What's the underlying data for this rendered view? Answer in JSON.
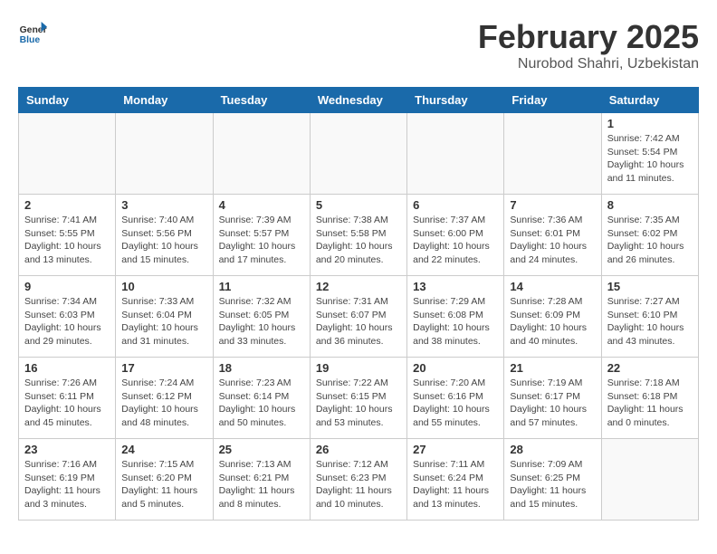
{
  "header": {
    "logo_general": "General",
    "logo_blue": "Blue",
    "month_title": "February 2025",
    "location": "Nurobod Shahri, Uzbekistan"
  },
  "weekdays": [
    "Sunday",
    "Monday",
    "Tuesday",
    "Wednesday",
    "Thursday",
    "Friday",
    "Saturday"
  ],
  "weeks": [
    [
      {
        "day": "",
        "info": ""
      },
      {
        "day": "",
        "info": ""
      },
      {
        "day": "",
        "info": ""
      },
      {
        "day": "",
        "info": ""
      },
      {
        "day": "",
        "info": ""
      },
      {
        "day": "",
        "info": ""
      },
      {
        "day": "1",
        "info": "Sunrise: 7:42 AM\nSunset: 5:54 PM\nDaylight: 10 hours\nand 11 minutes."
      }
    ],
    [
      {
        "day": "2",
        "info": "Sunrise: 7:41 AM\nSunset: 5:55 PM\nDaylight: 10 hours\nand 13 minutes."
      },
      {
        "day": "3",
        "info": "Sunrise: 7:40 AM\nSunset: 5:56 PM\nDaylight: 10 hours\nand 15 minutes."
      },
      {
        "day": "4",
        "info": "Sunrise: 7:39 AM\nSunset: 5:57 PM\nDaylight: 10 hours\nand 17 minutes."
      },
      {
        "day": "5",
        "info": "Sunrise: 7:38 AM\nSunset: 5:58 PM\nDaylight: 10 hours\nand 20 minutes."
      },
      {
        "day": "6",
        "info": "Sunrise: 7:37 AM\nSunset: 6:00 PM\nDaylight: 10 hours\nand 22 minutes."
      },
      {
        "day": "7",
        "info": "Sunrise: 7:36 AM\nSunset: 6:01 PM\nDaylight: 10 hours\nand 24 minutes."
      },
      {
        "day": "8",
        "info": "Sunrise: 7:35 AM\nSunset: 6:02 PM\nDaylight: 10 hours\nand 26 minutes."
      }
    ],
    [
      {
        "day": "9",
        "info": "Sunrise: 7:34 AM\nSunset: 6:03 PM\nDaylight: 10 hours\nand 29 minutes."
      },
      {
        "day": "10",
        "info": "Sunrise: 7:33 AM\nSunset: 6:04 PM\nDaylight: 10 hours\nand 31 minutes."
      },
      {
        "day": "11",
        "info": "Sunrise: 7:32 AM\nSunset: 6:05 PM\nDaylight: 10 hours\nand 33 minutes."
      },
      {
        "day": "12",
        "info": "Sunrise: 7:31 AM\nSunset: 6:07 PM\nDaylight: 10 hours\nand 36 minutes."
      },
      {
        "day": "13",
        "info": "Sunrise: 7:29 AM\nSunset: 6:08 PM\nDaylight: 10 hours\nand 38 minutes."
      },
      {
        "day": "14",
        "info": "Sunrise: 7:28 AM\nSunset: 6:09 PM\nDaylight: 10 hours\nand 40 minutes."
      },
      {
        "day": "15",
        "info": "Sunrise: 7:27 AM\nSunset: 6:10 PM\nDaylight: 10 hours\nand 43 minutes."
      }
    ],
    [
      {
        "day": "16",
        "info": "Sunrise: 7:26 AM\nSunset: 6:11 PM\nDaylight: 10 hours\nand 45 minutes."
      },
      {
        "day": "17",
        "info": "Sunrise: 7:24 AM\nSunset: 6:12 PM\nDaylight: 10 hours\nand 48 minutes."
      },
      {
        "day": "18",
        "info": "Sunrise: 7:23 AM\nSunset: 6:14 PM\nDaylight: 10 hours\nand 50 minutes."
      },
      {
        "day": "19",
        "info": "Sunrise: 7:22 AM\nSunset: 6:15 PM\nDaylight: 10 hours\nand 53 minutes."
      },
      {
        "day": "20",
        "info": "Sunrise: 7:20 AM\nSunset: 6:16 PM\nDaylight: 10 hours\nand 55 minutes."
      },
      {
        "day": "21",
        "info": "Sunrise: 7:19 AM\nSunset: 6:17 PM\nDaylight: 10 hours\nand 57 minutes."
      },
      {
        "day": "22",
        "info": "Sunrise: 7:18 AM\nSunset: 6:18 PM\nDaylight: 11 hours\nand 0 minutes."
      }
    ],
    [
      {
        "day": "23",
        "info": "Sunrise: 7:16 AM\nSunset: 6:19 PM\nDaylight: 11 hours\nand 3 minutes."
      },
      {
        "day": "24",
        "info": "Sunrise: 7:15 AM\nSunset: 6:20 PM\nDaylight: 11 hours\nand 5 minutes."
      },
      {
        "day": "25",
        "info": "Sunrise: 7:13 AM\nSunset: 6:21 PM\nDaylight: 11 hours\nand 8 minutes."
      },
      {
        "day": "26",
        "info": "Sunrise: 7:12 AM\nSunset: 6:23 PM\nDaylight: 11 hours\nand 10 minutes."
      },
      {
        "day": "27",
        "info": "Sunrise: 7:11 AM\nSunset: 6:24 PM\nDaylight: 11 hours\nand 13 minutes."
      },
      {
        "day": "28",
        "info": "Sunrise: 7:09 AM\nSunset: 6:25 PM\nDaylight: 11 hours\nand 15 minutes."
      },
      {
        "day": "",
        "info": ""
      }
    ]
  ]
}
